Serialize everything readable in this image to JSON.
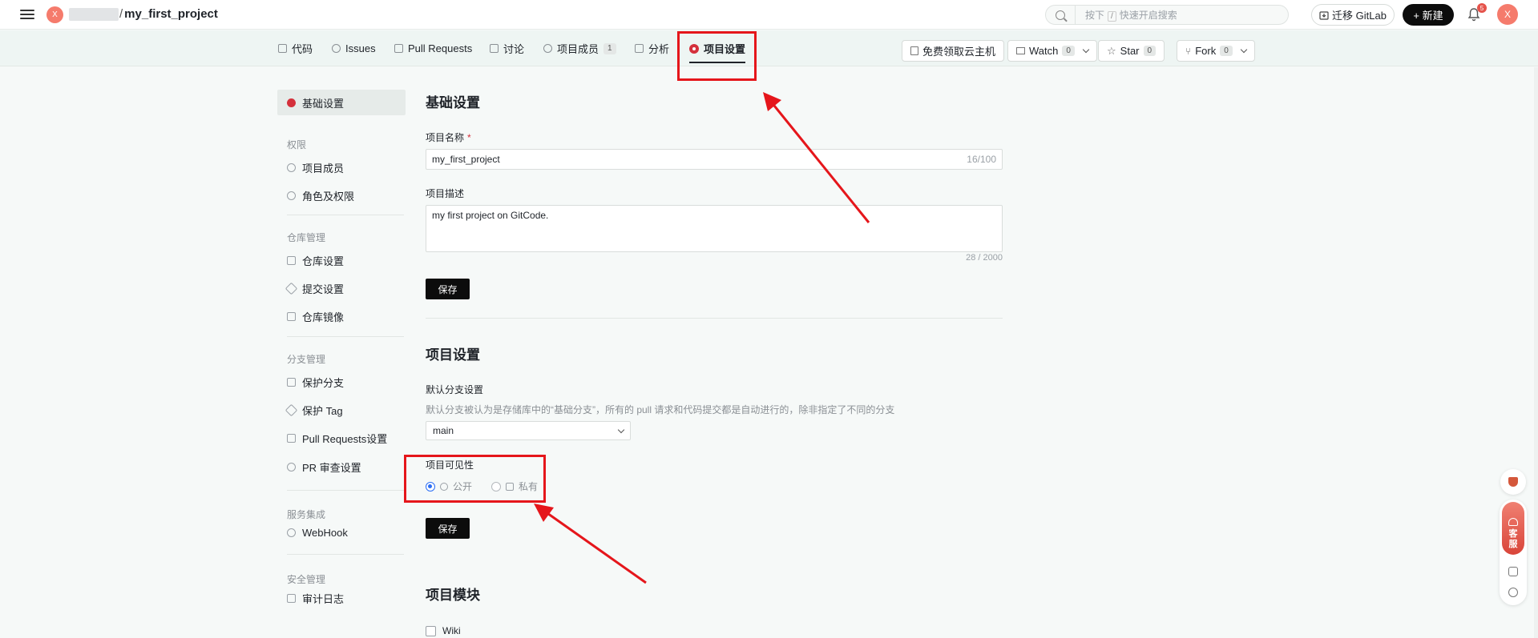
{
  "topbar": {
    "avatar_initial": "X",
    "repo_path_separator": "/",
    "repo_name": "my_first_project",
    "search": {
      "prefix": "按下",
      "key": "/",
      "suffix": "快速开启搜索"
    },
    "migrate_label": "迁移 GitLab",
    "new_label": "+ 新建",
    "notification_count": "5",
    "user_initial": "X"
  },
  "nav": {
    "tabs": [
      {
        "label": "代码"
      },
      {
        "label": "Issues"
      },
      {
        "label": "Pull Requests"
      },
      {
        "label": "讨论"
      },
      {
        "label": "项目成员",
        "count": "1"
      },
      {
        "label": "分析"
      },
      {
        "label": "项目设置"
      }
    ],
    "cloud_label": "免费领取云主机",
    "watch": {
      "label": "Watch",
      "count": "0"
    },
    "star": {
      "label": "Star",
      "count": "0"
    },
    "fork": {
      "label": "Fork",
      "count": "0"
    }
  },
  "sidebar": {
    "basic": "基础设置",
    "groups": {
      "permissions": "权限",
      "repo": "仓库管理",
      "branch": "分支管理",
      "services": "服务集成",
      "security": "安全管理"
    },
    "items": {
      "members": "项目成员",
      "roles": "角色及权限",
      "repo_settings": "仓库设置",
      "commit_settings": "提交设置",
      "repo_mirror": "仓库镜像",
      "protected_branch": "保护分支",
      "protected_tag": "保护 Tag",
      "pr_settings": "Pull Requests设置",
      "pr_review": "PR 审查设置",
      "webhook": "WebHook",
      "audit_log": "审计日志"
    }
  },
  "basic_settings": {
    "title": "基础设置",
    "name_label": "项目名称",
    "name_required": "*",
    "name_value": "my_first_project",
    "name_count": "16/100",
    "desc_label": "项目描述",
    "desc_value": "my first project on GitCode.",
    "desc_count": "28 / 2000",
    "save_label": "保存"
  },
  "project_settings": {
    "title": "项目设置",
    "branch_label": "默认分支设置",
    "branch_desc": "默认分支被认为是存储库中的“基础分支”，所有的 pull 请求和代码提交都是自动进行的，除非指定了不同的分支",
    "branch_value": "main",
    "visibility_label": "项目可见性",
    "visibility_options": {
      "public": "公开",
      "private": "私有"
    },
    "visibility_selected": "public",
    "save_label": "保存"
  },
  "modules": {
    "title": "项目模块",
    "wiki_label": "Wiki"
  },
  "float_panel": {
    "service_label_1": "客",
    "service_label_2": "服"
  },
  "colors": {
    "accent_dark": "#0c0c0c",
    "brand_red": "#d4303b",
    "annotation_red": "#e5161b",
    "radio_blue": "#2b6ef5"
  }
}
